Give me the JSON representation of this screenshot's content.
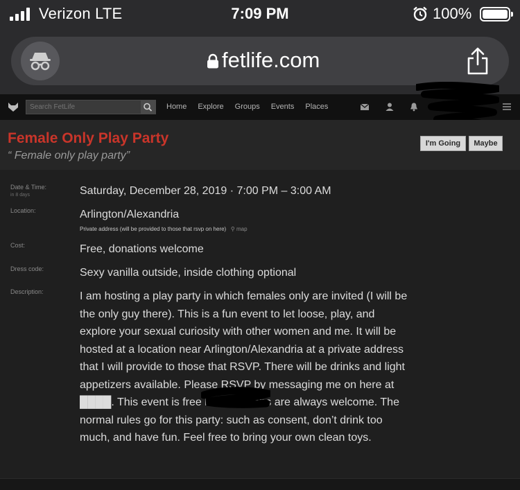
{
  "status_bar": {
    "carrier": "Verizon  LTE",
    "time": "7:09 PM",
    "battery": "100%",
    "icons": [
      "signal-icon",
      "alarm-icon",
      "battery-icon"
    ]
  },
  "browser": {
    "url": "fetlife.com",
    "icons": [
      "incognito-icon",
      "lock-icon",
      "share-icon"
    ]
  },
  "site_nav": {
    "search_placeholder": "Search FetLife",
    "links": [
      "Home",
      "Explore",
      "Groups",
      "Events",
      "Places"
    ],
    "icons": [
      "fetlife-logo-icon",
      "search-icon",
      "inbox-icon",
      "user-icon",
      "notifications-icon",
      "menu-icon"
    ]
  },
  "event": {
    "title": "Female Only Play Party",
    "quote": "“ Female only play party”",
    "going_label": "I'm Going",
    "maybe_label": "Maybe",
    "date_label": "Date & Time:",
    "date_sub": "in 8 days",
    "date_value": "Saturday, December 28, 2019 · 7:00 PM – 3:00 AM",
    "location_label": "Location:",
    "location_value": "Arlington/Alexandria",
    "location_note": "Private address (will be provided to those that rsvp on here)",
    "map_label": "map",
    "cost_label": "Cost:",
    "cost_value": "Free, donations welcome",
    "dress_label": "Dress code:",
    "dress_value": "Sexy vanilla outside, inside clothing optional",
    "description_label": "Description:",
    "description": "I am hosting a play party in which females only are invited (I will be the only guy there). This is a fun event to let loose, play, and explore your sexual curiosity with other women and me. It will be hosted at a location near Arlington/Alexandria at a private address that I will provide to those that RSVP. There will be drinks and light appetizers available. Please RSVP by messaging me on here at ████. This event is free but donations are always welcome. The normal rules go for this party: such as consent, don’t drink too much, and have fun. Feel free to bring your own clean toys."
  },
  "colors": {
    "title_red": "#c9352a",
    "nav_bg": "#111111",
    "page_bg": "#1f1f1f"
  }
}
